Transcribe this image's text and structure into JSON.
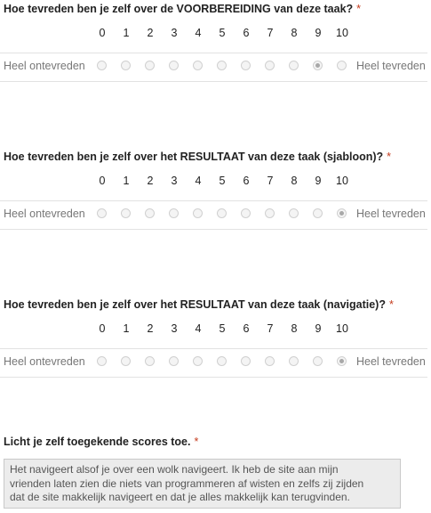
{
  "required_marker": "*",
  "scale": {
    "numbers": [
      "0",
      "1",
      "2",
      "3",
      "4",
      "5",
      "6",
      "7",
      "8",
      "9",
      "10"
    ],
    "low_label": "Heel ontevreden",
    "high_label": "Heel tevreden"
  },
  "questions": [
    {
      "title": "Hoe tevreden ben je zelf over de VOORBEREIDING van deze taak?",
      "selected": "9"
    },
    {
      "title": "Hoe tevreden ben je zelf over het RESULTAAT van deze taak (sjabloon)?",
      "selected": "10"
    },
    {
      "title": "Hoe tevreden ben je zelf over het RESULTAAT van deze taak (navigatie)?",
      "selected": "10"
    }
  ],
  "comment": {
    "title": "Licht je zelf toegekende scores toe.",
    "value": "Het navigeert alsof je over een wolk navigeert. Ik heb de site aan mijn\nvrienden laten zien die niets van programmeren af wisten en zelfs zij zijden\ndat de site makkelijk navigeert en dat je alles makkelijk kan terugvinden."
  }
}
